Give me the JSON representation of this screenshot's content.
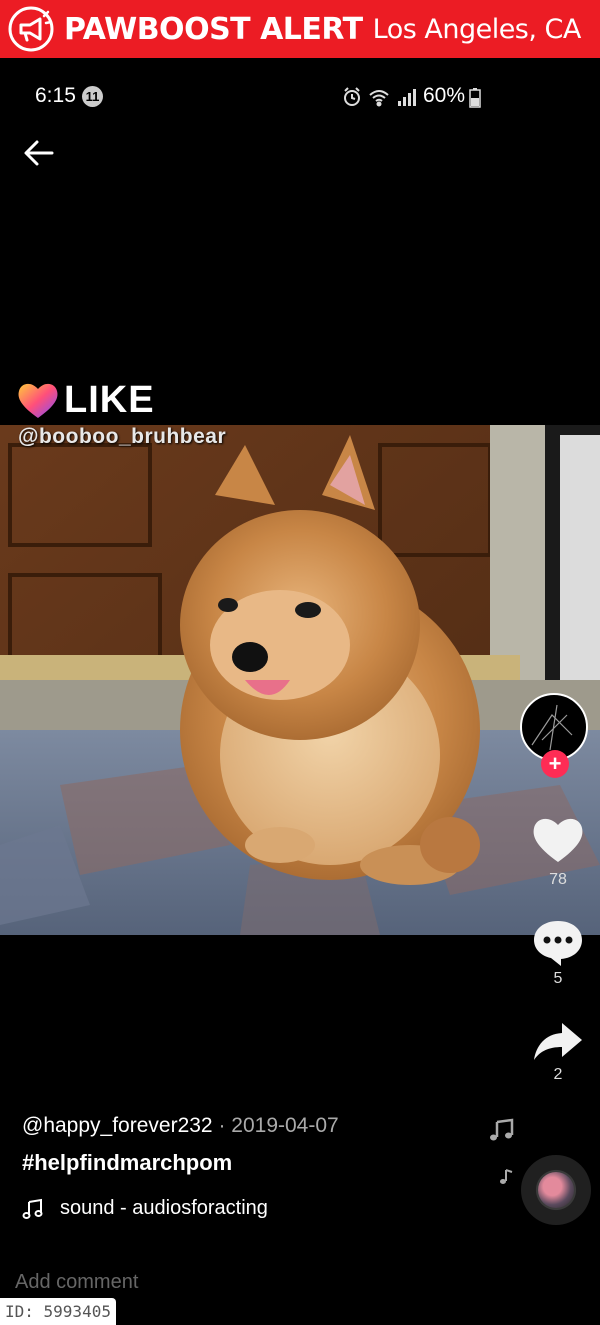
{
  "banner": {
    "brand": "PAWBOOST ALERT",
    "location": "Los Angeles, CA",
    "color": "#ec1c24"
  },
  "status_bar": {
    "time": "6:15",
    "notification_count": "11",
    "battery": "60%"
  },
  "video": {
    "logo_text": "LIKE",
    "watermark": "@booboo_bruhbear"
  },
  "actions": {
    "likes": "78",
    "comments": "5",
    "shares": "2",
    "follow_symbol": "+"
  },
  "caption": {
    "username": "@happy_forever232",
    "separator": " · ",
    "date": "2019-04-07",
    "hashtag": "#helpfindmarchpom",
    "sound": "sound - audiosforacting"
  },
  "comment_placeholder": "Add comment",
  "listing_id": "ID: 5993405",
  "icons": [
    "megaphone-icon",
    "back-arrow-icon",
    "heart-icon",
    "comment-icon",
    "share-icon",
    "music-note-icon",
    "alarm-icon",
    "wifi-icon",
    "signal-icon",
    "battery-icon"
  ]
}
